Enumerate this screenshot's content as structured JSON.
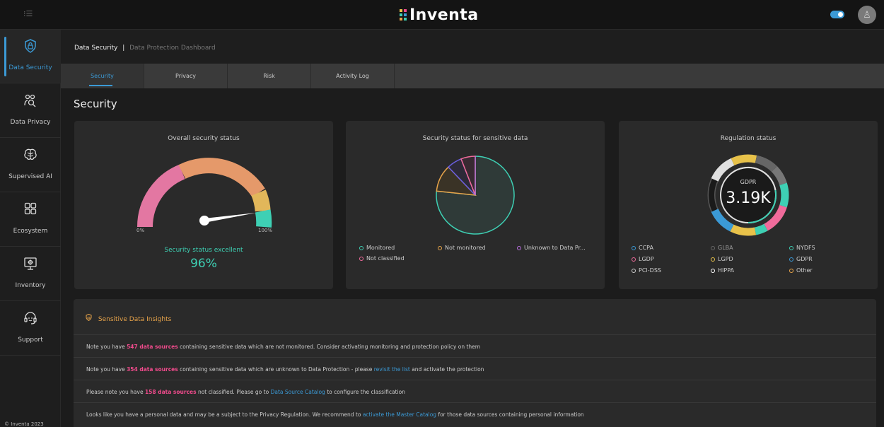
{
  "header": {
    "logo_text": "Inventa",
    "menu_icon": "menu-icon",
    "theme_toggle": "on",
    "avatar_icon": "user-avatar-icon"
  },
  "sidebar": {
    "items": [
      {
        "label": "Data Security",
        "icon": "lock-shield-icon",
        "active": true
      },
      {
        "label": "Data Privacy",
        "icon": "users-search-icon",
        "active": false
      },
      {
        "label": "Supervised AI",
        "icon": "brain-icon",
        "active": false
      },
      {
        "label": "Ecosystem",
        "icon": "grid-icon",
        "active": false
      },
      {
        "label": "Inventory",
        "icon": "monitor-gear-icon",
        "active": false
      },
      {
        "label": "Support",
        "icon": "headset-icon",
        "active": false
      }
    ],
    "copyright": "© Inventa 2023"
  },
  "breadcrumb": {
    "main": "Data Security",
    "separator": "|",
    "sub": "Data Protection Dashboard"
  },
  "tabs": [
    {
      "label": "Security",
      "active": true
    },
    {
      "label": "Privacy",
      "active": false
    },
    {
      "label": "Risk",
      "active": false
    },
    {
      "label": "Activity Log",
      "active": false
    }
  ],
  "page_title": "Security",
  "overall": {
    "title": "Overall security status",
    "min_label": "0%",
    "max_label": "100%",
    "status_text": "Security status excellent",
    "value_text": "96%",
    "value": 96
  },
  "sensitive": {
    "title": "Security status for sensitive data",
    "legend": [
      {
        "label": "Monitored",
        "color": "#3ed0b4"
      },
      {
        "label": "Not monitored",
        "color": "#e8a44a"
      },
      {
        "label": "Unknown to Data Pr...",
        "color": "#b86ee0"
      },
      {
        "label": "Not classified",
        "color": "#f06b9b"
      }
    ]
  },
  "regulation": {
    "title": "Regulation status",
    "center_label": "GDPR",
    "center_value": "3.19K",
    "legend": [
      {
        "label": "CCPA",
        "color": "#3b9ad6"
      },
      {
        "label": "GLBA",
        "color": "#666666"
      },
      {
        "label": "NYDFS",
        "color": "#3ed0b4"
      },
      {
        "label": "LGDP",
        "color": "#f06b9b"
      },
      {
        "label": "LGPD",
        "color": "#e8c24a"
      },
      {
        "label": "GDPR",
        "color": "#3b9ad6"
      },
      {
        "label": "PCI-DSS",
        "color": "#cccccc"
      },
      {
        "label": "HIPPA",
        "color": "#ffffff"
      },
      {
        "label": "Other",
        "color": "#e8a44a"
      }
    ]
  },
  "insights": {
    "title": "Sensitive Data Insights",
    "rows": [
      {
        "pre": "Note you have ",
        "highlight": "547 data sources",
        "mid": " containing sensitive data which are not monitored. Consider activating monitoring and protection policy on them",
        "link": "",
        "post": ""
      },
      {
        "pre": "Note you have ",
        "highlight": "354 data sources",
        "mid": " containing sensitive data which are unknown to Data Protection - please ",
        "link": "revisit the list",
        "post": " and activate the protection"
      },
      {
        "pre": "Please note you have ",
        "highlight": "158 data sources",
        "mid": " not classified. Please go to ",
        "link": "Data Source Catalog",
        "post": " to configure the classification"
      },
      {
        "pre": "Looks like you have a personal data and may be a subject to the Privacy Regulation. We recommend to ",
        "highlight": "",
        "mid": "",
        "link": "activate the Master Catalog",
        "post": " for those data sources containing personal information"
      }
    ]
  }
}
